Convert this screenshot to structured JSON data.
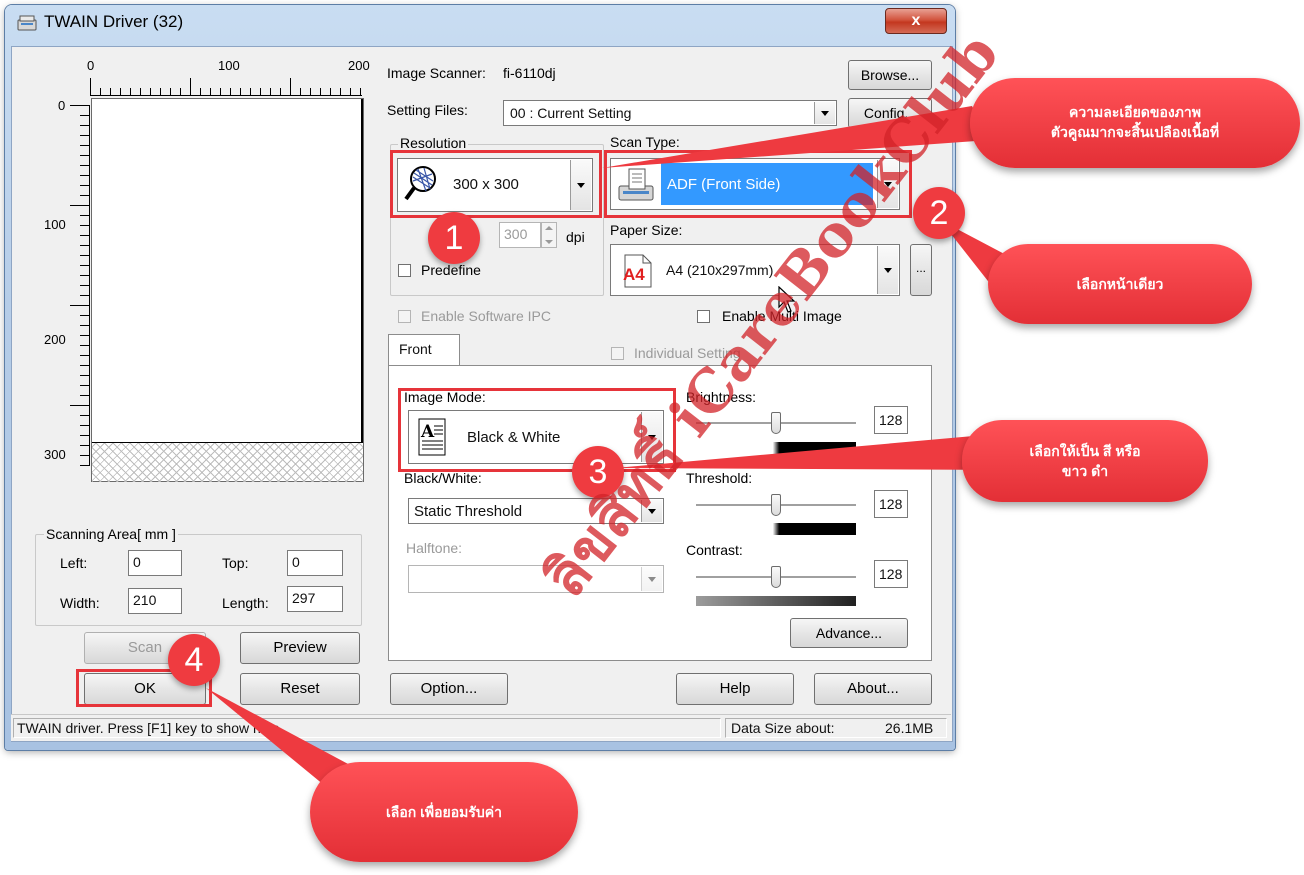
{
  "window": {
    "title": "TWAIN Driver (32)",
    "close_label": "x"
  },
  "preview": {
    "ruler_top": [
      "0",
      "100",
      "200"
    ],
    "ruler_left": [
      "0",
      "100",
      "200",
      "300"
    ]
  },
  "scanning_area": {
    "legend": "Scanning Area[ mm ]",
    "left_label": "Left:",
    "left_value": "0",
    "top_label": "Top:",
    "top_value": "0",
    "width_label": "Width:",
    "width_value": "210",
    "length_label": "Length:",
    "length_value": "297"
  },
  "buttons": {
    "scan": "Scan",
    "preview": "Preview",
    "ok": "OK",
    "reset": "Reset",
    "option": "Option...",
    "help": "Help",
    "about": "About...",
    "browse": "Browse...",
    "config": "Config...",
    "advance": "Advance...",
    "paper_more": "..."
  },
  "scanner": {
    "image_scanner_label": "Image Scanner:",
    "image_scanner_value": "fi-6110dj",
    "setting_files_label": "Setting Files:",
    "setting_files_value": "00 : Current Setting"
  },
  "resolution": {
    "legend": "Resolution",
    "value": "300 x 300",
    "dpi_value": "300",
    "dpi_label": "dpi",
    "predefine_label": "Predefine"
  },
  "scan_type": {
    "legend": "Scan Type:",
    "value": "ADF (Front Side)"
  },
  "paper_size": {
    "label": "Paper Size:",
    "value": "A4 (210x297mm)",
    "icon_text": "A4"
  },
  "options": {
    "enable_ipc": "Enable Software IPC",
    "enable_multi": "Enable Multi Image",
    "individual_setting": "Individual Setting"
  },
  "tab": {
    "front": "Front"
  },
  "image_mode": {
    "label": "Image Mode:",
    "value": "Black & White"
  },
  "bw": {
    "label": "Black/White:",
    "value": "Static Threshold"
  },
  "halftone": {
    "label": "Halftone:"
  },
  "brightness": {
    "label": "Brightness:",
    "value": "128",
    "level": 0.5
  },
  "threshold": {
    "label": "Threshold:",
    "value": "128",
    "level": 0.5
  },
  "contrast": {
    "label": "Contrast:",
    "value": "128",
    "level": 0.5
  },
  "status": {
    "help_text": "TWAIN driver. Press [F1] key to show help.",
    "data_size_label": "Data Size about:",
    "data_size_value": "26.1MB"
  },
  "annotations": {
    "callout_1": "ความละเอียดของภาพ\nตัวคูณมากจะสิ้นเปลืองเนื้อที่",
    "callout_2": "เลือกหน้าเดียว",
    "callout_3": "เลือกให้เป็น สี หรือ\nขาว ดำ",
    "callout_4": "เลือก เพื่อยอมรับค่า",
    "badge_1": "1",
    "badge_2": "2",
    "badge_3": "3",
    "badge_4": "4",
    "watermark": "ลิขสิทธิ์ iCareBookClub"
  }
}
